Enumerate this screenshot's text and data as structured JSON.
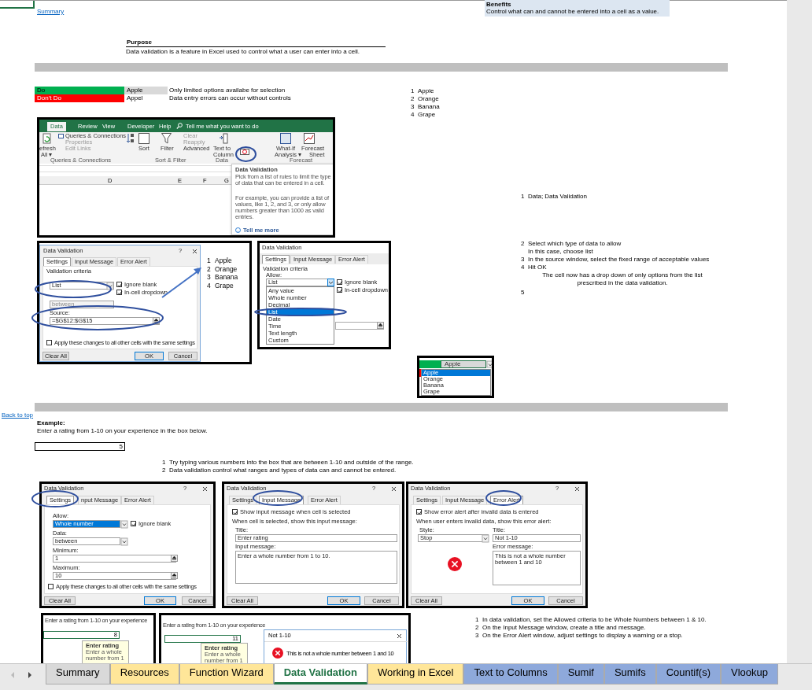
{
  "links": {
    "summary": "Summary",
    "back_to_top": "Back to top"
  },
  "benefits": {
    "title": "Benefits",
    "text": "Control what can and cannot be entered into a cell as a value."
  },
  "purpose": {
    "title": "Purpose",
    "text": "Data validation is a feature in Excel used to control what a user can enter into a cell."
  },
  "comparison": [
    {
      "label": "Do",
      "color": "#00b050",
      "value": "Apple",
      "text": "Only limited options availabe for selection"
    },
    {
      "label": "Don't Do",
      "color": "#ff0000",
      "value": "Appel",
      "text": "Data entry errors can occur without controls"
    }
  ],
  "fruit_list": [
    {
      "number": "1",
      "name": "Apple"
    },
    {
      "number": "2",
      "name": "Orange"
    },
    {
      "number": "3",
      "name": "Banana"
    },
    {
      "number": "4",
      "name": "Grape"
    }
  ],
  "ribbon_shot": {
    "tabs": [
      {
        "label": "Data",
        "selected": true
      },
      {
        "label": "Review",
        "selected": false
      },
      {
        "label": "View",
        "selected": false
      },
      {
        "label": "Developer",
        "selected": false
      },
      {
        "label": "Help",
        "selected": false
      }
    ],
    "search": "Tell me what you want to do",
    "commands": [
      {
        "label": "efresh",
        "disabled": false
      },
      {
        "label": "All ▾",
        "disabled": false
      },
      {
        "label": "Queries & Connections",
        "disabled": false
      },
      {
        "label": "Properties",
        "disabled": true
      },
      {
        "label": "Edit Links",
        "disabled": true
      },
      {
        "label": "Sort",
        "disabled": false
      },
      {
        "label": "Filter",
        "disabled": false
      },
      {
        "label": "Clear",
        "disabled": true
      },
      {
        "label": "Reapply",
        "disabled": true
      },
      {
        "label": "Advanced",
        "disabled": false
      },
      {
        "label": "Text to",
        "disabled": false
      },
      {
        "label": "Column",
        "disabled": false
      },
      {
        "label": "What-If",
        "disabled": false
      },
      {
        "label": "Analysis ▾",
        "disabled": false
      },
      {
        "label": "Forecast",
        "disabled": false
      },
      {
        "label": "Sheet",
        "disabled": false
      }
    ],
    "groups": [
      "Queries & Connections",
      "Sort & Filter",
      "Data",
      "Forecast"
    ],
    "columns": [
      "D",
      "E",
      "F",
      "G"
    ],
    "tooltip": {
      "title": "Data Validation",
      "paragraphs": [
        "Pick from a list of rules to limit the type of data that can be entered in a cell.",
        "For example, you can provide a list of values, like 1, 2, and 3, or only allow numbers greater than 1000 as valid entries."
      ],
      "link": "Tell me more"
    }
  },
  "list_dialog": {
    "title": "Data Validation",
    "help": "?",
    "tabs": [
      {
        "label": "Settings",
        "selected": true
      },
      {
        "label": "Input Message",
        "selected": false
      },
      {
        "label": "Error Alert",
        "selected": false
      }
    ],
    "section": "Validation criteria",
    "allow_value": "List",
    "checks": [
      {
        "label": "Ignore blank",
        "checked": true
      },
      {
        "label": "In-cell dropdown",
        "checked": true
      }
    ],
    "data_value": "between",
    "source_label": "Source:",
    "source_value": "=$G$12:$G$15",
    "apply": {
      "label": "Apply these changes to all other cells with the same settings",
      "checked": false
    },
    "buttons": [
      "Clear All",
      "OK",
      "Cancel"
    ]
  },
  "list_preview": [
    {
      "number": "1",
      "name": "Apple"
    },
    {
      "number": "2",
      "name": "Orange"
    },
    {
      "number": "3",
      "name": "Banana"
    },
    {
      "number": "4",
      "name": "Grape"
    }
  ],
  "allow_dialog": {
    "title": "Data Validation",
    "tabs": [
      {
        "label": "Settings",
        "selected": true
      },
      {
        "label": "Input Message",
        "selected": false
      },
      {
        "label": "Error Alert",
        "selected": false
      }
    ],
    "section": "Validation criteria",
    "allow_label": "Allow:",
    "allow_value": "List",
    "checks": [
      {
        "label": "Ignore blank",
        "checked": true
      },
      {
        "label": "In-cell dropdown",
        "checked": true
      }
    ],
    "options": [
      {
        "label": "Any value",
        "selected": false
      },
      {
        "label": "Whole number",
        "selected": false
      },
      {
        "label": "Decimal",
        "selected": false
      },
      {
        "label": "List",
        "selected": true
      },
      {
        "label": "Date",
        "selected": false
      },
      {
        "label": "Time",
        "selected": false
      },
      {
        "label": "Text length",
        "selected": false
      },
      {
        "label": "Custom",
        "selected": false
      }
    ]
  },
  "dropdown_shot": {
    "value": "Apple",
    "options": [
      {
        "label": "Apple",
        "selected": true
      },
      {
        "label": "Orange",
        "selected": false
      },
      {
        "label": "Banana",
        "selected": false
      },
      {
        "label": "Grape",
        "selected": false
      }
    ]
  },
  "steps": [
    {
      "number": "1",
      "text": "Data; Data Validation"
    },
    {
      "number": "2",
      "text": "Select which type of data to allow",
      "notes": [
        "In this case, choose list"
      ]
    },
    {
      "number": "3",
      "text": "In the source window, select the fixed range of acceptable values"
    },
    {
      "number": "4",
      "text": "Hit OK",
      "notes": [
        "The cell now has a drop down of only options from the list",
        "prescribed in the data validation."
      ]
    },
    {
      "number": "5"
    }
  ],
  "example": {
    "title": "Example:",
    "text": "Enter a rating from 1-10 on your experience in the box below.",
    "value": "5"
  },
  "example_steps": [
    {
      "number": "1",
      "text": "Try typing various numbers into the box that are between 1-10 and outside of the range."
    },
    {
      "number": "2",
      "text": "Data validation control what ranges and types of data can and cannot be entered."
    }
  ],
  "settings_dialog": {
    "title": "Data Validation",
    "help": "?",
    "tabs": [
      {
        "label": "Settings",
        "selected": true
      },
      {
        "label": "nput Message",
        "selected": false
      },
      {
        "label": "Error Alert",
        "selected": false
      }
    ],
    "allow_label": "Allow:",
    "allow_value": "Whole number",
    "check": {
      "label": "Ignore blank",
      "checked": true
    },
    "data_label": "Data:",
    "data_value": "between",
    "minimum_label": "Minimum:",
    "minimum": "1",
    "maximum_label": "Maximum:",
    "maximum": "10",
    "apply": {
      "label": "Apply these changes to all other cells with the same settings",
      "checked": false
    },
    "buttons": [
      "Clear All",
      "OK",
      "Cancel"
    ]
  },
  "input_dialog": {
    "title": "Data Validation",
    "help": "?",
    "tabs": [
      {
        "label": "Settings",
        "selected": false
      },
      {
        "label": "Input Message",
        "selected": true
      },
      {
        "label": "Error Alert",
        "selected": false
      }
    ],
    "check": {
      "label": "Show input message when cell is selected",
      "checked": true
    },
    "section": "When cell is selected, show this input message:",
    "title_label": "Title:",
    "title_value": "Enter rating",
    "message_label": "Input message:",
    "message_value": "Enter a whole number from 1 to 10.",
    "buttons": [
      "Clear All",
      "OK",
      "Cancel"
    ]
  },
  "error_dialog": {
    "title": "Data Validation",
    "help": "?",
    "tabs": [
      {
        "label": "Settings",
        "selected": false
      },
      {
        "label": "Input Message",
        "selected": false
      },
      {
        "label": "Error Alert",
        "selected": true
      }
    ],
    "check": {
      "label": "Show error alert after invalid data is entered",
      "checked": true
    },
    "section": "When user enters invalid data, show this error alert:",
    "style_label": "Style:",
    "style_value": "Stop",
    "title_label": "Title:",
    "title_value": "Not 1-10",
    "message_label": "Error message:",
    "message_value": "This is not a whole number between 1 and 10",
    "buttons": [
      "Clear All",
      "OK",
      "Cancel"
    ]
  },
  "result_shots": [
    {
      "prompt": "Enter a rating from 1-10 on your experience",
      "value": "8",
      "tip_title": "Enter rating",
      "tip_lines": [
        "Enter a whole",
        "number from 1"
      ]
    },
    {
      "prompt": "Enter a rating from 1-10 on your experience",
      "value": "11",
      "tip_title": "Enter rating",
      "tip_lines": [
        "Enter a whole",
        "number from 1"
      ],
      "alert": {
        "title": "Not 1-10",
        "message": "This is not a whole number between 1 and 10"
      }
    }
  ],
  "final_steps": [
    {
      "number": "1",
      "text": "In data validation, set the Allowed criteria to be Whole Numbers between 1 & 10."
    },
    {
      "number": "2",
      "text": "On the Input Message window, create a title and message."
    },
    {
      "number": "3",
      "text": "On the Error Alert window, adjust settings to display a warning or a stop."
    }
  ],
  "sheet_tabs": [
    {
      "label": "Summary",
      "selected": false,
      "color": "#d9d9d9"
    },
    {
      "label": "Resources",
      "selected": false,
      "color": "#ffe699"
    },
    {
      "label": "Function Wizard",
      "selected": false,
      "color": "#ffe699"
    },
    {
      "label": "Data Validation",
      "selected": true
    },
    {
      "label": "Working in Excel",
      "selected": false,
      "color": "#ffe699"
    },
    {
      "label": "Text to Columns",
      "selected": false,
      "color": "#8ea9db"
    },
    {
      "label": "Sumif",
      "selected": false,
      "color": "#8ea9db"
    },
    {
      "label": "Sumifs",
      "selected": false,
      "color": "#8ea9db"
    },
    {
      "label": "Countif(s)",
      "selected": false,
      "color": "#8ea9db"
    },
    {
      "label": "Vlookup",
      "selected": false,
      "color": "#8ea9db"
    }
  ]
}
